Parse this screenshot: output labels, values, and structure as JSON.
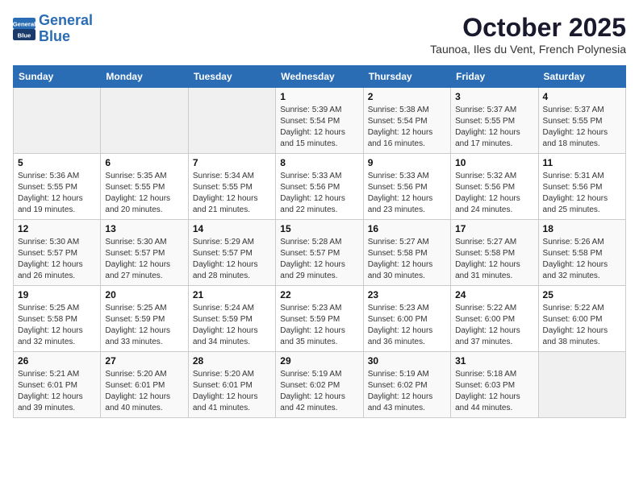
{
  "logo": {
    "line1": "General",
    "line2": "Blue"
  },
  "title": "October 2025",
  "location": "Taunoa, Iles du Vent, French Polynesia",
  "weekdays": [
    "Sunday",
    "Monday",
    "Tuesday",
    "Wednesday",
    "Thursday",
    "Friday",
    "Saturday"
  ],
  "weeks": [
    [
      {
        "day": "",
        "info": ""
      },
      {
        "day": "",
        "info": ""
      },
      {
        "day": "",
        "info": ""
      },
      {
        "day": "1",
        "info": "Sunrise: 5:39 AM\nSunset: 5:54 PM\nDaylight: 12 hours\nand 15 minutes."
      },
      {
        "day": "2",
        "info": "Sunrise: 5:38 AM\nSunset: 5:54 PM\nDaylight: 12 hours\nand 16 minutes."
      },
      {
        "day": "3",
        "info": "Sunrise: 5:37 AM\nSunset: 5:55 PM\nDaylight: 12 hours\nand 17 minutes."
      },
      {
        "day": "4",
        "info": "Sunrise: 5:37 AM\nSunset: 5:55 PM\nDaylight: 12 hours\nand 18 minutes."
      }
    ],
    [
      {
        "day": "5",
        "info": "Sunrise: 5:36 AM\nSunset: 5:55 PM\nDaylight: 12 hours\nand 19 minutes."
      },
      {
        "day": "6",
        "info": "Sunrise: 5:35 AM\nSunset: 5:55 PM\nDaylight: 12 hours\nand 20 minutes."
      },
      {
        "day": "7",
        "info": "Sunrise: 5:34 AM\nSunset: 5:55 PM\nDaylight: 12 hours\nand 21 minutes."
      },
      {
        "day": "8",
        "info": "Sunrise: 5:33 AM\nSunset: 5:56 PM\nDaylight: 12 hours\nand 22 minutes."
      },
      {
        "day": "9",
        "info": "Sunrise: 5:33 AM\nSunset: 5:56 PM\nDaylight: 12 hours\nand 23 minutes."
      },
      {
        "day": "10",
        "info": "Sunrise: 5:32 AM\nSunset: 5:56 PM\nDaylight: 12 hours\nand 24 minutes."
      },
      {
        "day": "11",
        "info": "Sunrise: 5:31 AM\nSunset: 5:56 PM\nDaylight: 12 hours\nand 25 minutes."
      }
    ],
    [
      {
        "day": "12",
        "info": "Sunrise: 5:30 AM\nSunset: 5:57 PM\nDaylight: 12 hours\nand 26 minutes."
      },
      {
        "day": "13",
        "info": "Sunrise: 5:30 AM\nSunset: 5:57 PM\nDaylight: 12 hours\nand 27 minutes."
      },
      {
        "day": "14",
        "info": "Sunrise: 5:29 AM\nSunset: 5:57 PM\nDaylight: 12 hours\nand 28 minutes."
      },
      {
        "day": "15",
        "info": "Sunrise: 5:28 AM\nSunset: 5:57 PM\nDaylight: 12 hours\nand 29 minutes."
      },
      {
        "day": "16",
        "info": "Sunrise: 5:27 AM\nSunset: 5:58 PM\nDaylight: 12 hours\nand 30 minutes."
      },
      {
        "day": "17",
        "info": "Sunrise: 5:27 AM\nSunset: 5:58 PM\nDaylight: 12 hours\nand 31 minutes."
      },
      {
        "day": "18",
        "info": "Sunrise: 5:26 AM\nSunset: 5:58 PM\nDaylight: 12 hours\nand 32 minutes."
      }
    ],
    [
      {
        "day": "19",
        "info": "Sunrise: 5:25 AM\nSunset: 5:58 PM\nDaylight: 12 hours\nand 32 minutes."
      },
      {
        "day": "20",
        "info": "Sunrise: 5:25 AM\nSunset: 5:59 PM\nDaylight: 12 hours\nand 33 minutes."
      },
      {
        "day": "21",
        "info": "Sunrise: 5:24 AM\nSunset: 5:59 PM\nDaylight: 12 hours\nand 34 minutes."
      },
      {
        "day": "22",
        "info": "Sunrise: 5:23 AM\nSunset: 5:59 PM\nDaylight: 12 hours\nand 35 minutes."
      },
      {
        "day": "23",
        "info": "Sunrise: 5:23 AM\nSunset: 6:00 PM\nDaylight: 12 hours\nand 36 minutes."
      },
      {
        "day": "24",
        "info": "Sunrise: 5:22 AM\nSunset: 6:00 PM\nDaylight: 12 hours\nand 37 minutes."
      },
      {
        "day": "25",
        "info": "Sunrise: 5:22 AM\nSunset: 6:00 PM\nDaylight: 12 hours\nand 38 minutes."
      }
    ],
    [
      {
        "day": "26",
        "info": "Sunrise: 5:21 AM\nSunset: 6:01 PM\nDaylight: 12 hours\nand 39 minutes."
      },
      {
        "day": "27",
        "info": "Sunrise: 5:20 AM\nSunset: 6:01 PM\nDaylight: 12 hours\nand 40 minutes."
      },
      {
        "day": "28",
        "info": "Sunrise: 5:20 AM\nSunset: 6:01 PM\nDaylight: 12 hours\nand 41 minutes."
      },
      {
        "day": "29",
        "info": "Sunrise: 5:19 AM\nSunset: 6:02 PM\nDaylight: 12 hours\nand 42 minutes."
      },
      {
        "day": "30",
        "info": "Sunrise: 5:19 AM\nSunset: 6:02 PM\nDaylight: 12 hours\nand 43 minutes."
      },
      {
        "day": "31",
        "info": "Sunrise: 5:18 AM\nSunset: 6:03 PM\nDaylight: 12 hours\nand 44 minutes."
      },
      {
        "day": "",
        "info": ""
      }
    ]
  ]
}
